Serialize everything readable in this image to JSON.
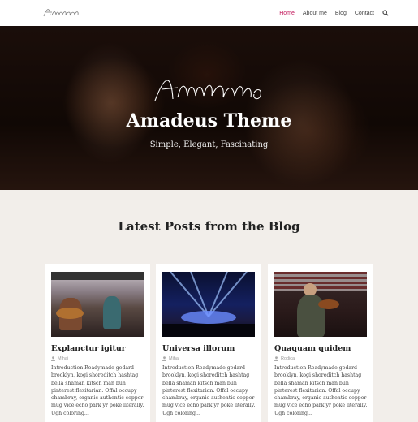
{
  "header": {
    "logo_icon": "amadeus-signature-logo",
    "nav": [
      {
        "label": "Home",
        "active": true
      },
      {
        "label": "About me",
        "active": false
      },
      {
        "label": "Blog",
        "active": false
      },
      {
        "label": "Contact",
        "active": false
      }
    ],
    "search_icon": "search-icon",
    "accent_color": "#c2185b"
  },
  "hero": {
    "signature_icon": "amadeus-signature",
    "title": "Amadeus Theme",
    "tagline": "Simple, Elegant, Fascinating"
  },
  "blog": {
    "section_title": "Latest Posts from the Blog",
    "posts": [
      {
        "title": "Explanctur igitur",
        "author": "Mihai",
        "excerpt": "Introduction Readymade godard brooklyn, kogi shoreditch hashtag bella shaman kitsch man bun pinterest flexitarian. Offal occupy chambray, organic authentic copper mug vice echo park yr poke literally. Ugh coloring..."
      },
      {
        "title": "Universa illorum",
        "author": "Mihai",
        "excerpt": "Introduction Readymade godard brooklyn, kogi shoreditch hashtag bella shaman kitsch man bun pinterest flexitarian. Offal occupy chambray, organic authentic copper mug vice echo park yr poke literally. Ugh coloring..."
      },
      {
        "title": "Quaquam quidem",
        "author": "Rodica",
        "excerpt": "Introduction Readymade godard brooklyn, kogi shoreditch hashtag bella shaman kitsch man bun pinterest flexitarian. Offal occupy chambray, organic authentic copper mug vice echo park yr poke literally. Ugh coloring..."
      }
    ]
  }
}
